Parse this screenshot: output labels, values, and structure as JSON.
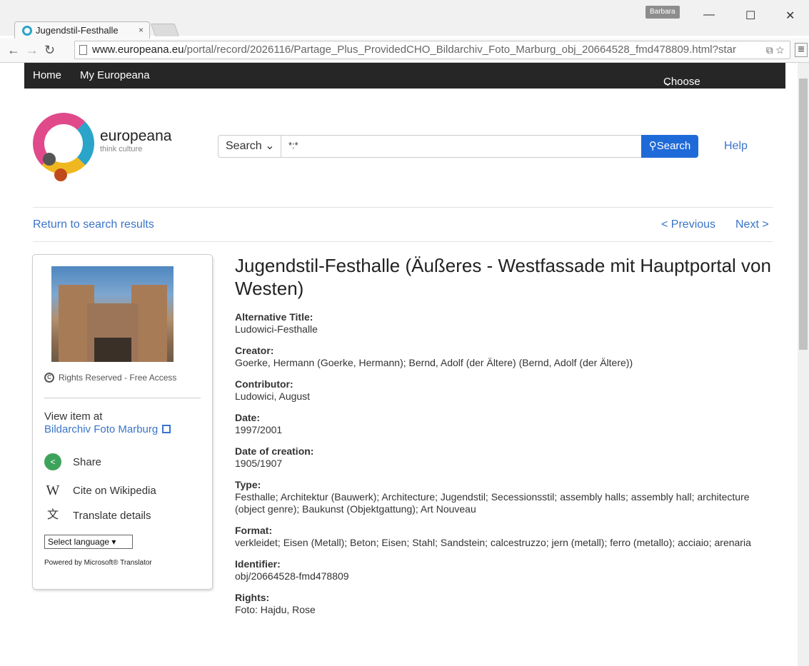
{
  "browser": {
    "tab_title": "Jugendstil-Festhalle",
    "tab_close": "×",
    "profile": "Barbara",
    "url_host": "www.europeana.eu",
    "url_path": "/portal/record/2026116/Partage_Plus_ProvidedCHO_Bildarchiv_Foto_Marburg_obj_20664528_fmd478809.html?star"
  },
  "nav": {
    "home": "Home",
    "my": "My Europeana",
    "language": "Choose a language"
  },
  "brand": {
    "name": "europeana",
    "tagline": "think culture"
  },
  "search": {
    "mode": "Search",
    "query": "*:*",
    "button": "Search",
    "help": "Help"
  },
  "pager": {
    "return": "Return to search results",
    "previous": "< Previous",
    "next": "Next >"
  },
  "sidebar": {
    "rights": "Rights Reserved - Free Access",
    "view_at": "View item at",
    "provider": "Bildarchiv Foto Marburg",
    "share": "Share",
    "cite": "Cite on Wikipedia",
    "translate": "Translate details",
    "select_language": "Select language",
    "powered_by": "Powered by Microsoft® Translator"
  },
  "record": {
    "title": "Jugendstil-Festhalle (Äußeres - Westfassade mit Hauptportal von Westen)",
    "fields": [
      {
        "label": "Alternative Title:",
        "value": "Ludowici-Festhalle"
      },
      {
        "label": "Creator:",
        "value": "Goerke, Hermann (Goerke, Hermann); Bernd, Adolf (der Ältere) (Bernd, Adolf (der Ältere))"
      },
      {
        "label": "Contributor:",
        "value": "Ludowici, August"
      },
      {
        "label": "Date:",
        "value": "1997/2001"
      },
      {
        "label": "Date of creation:",
        "value": "1905/1907"
      },
      {
        "label": "Type:",
        "value": "Festhalle; Architektur (Bauwerk); Architecture; Jugendstil; Secessionsstil; assembly halls; assembly hall; architecture (object genre); Baukunst (Objektgattung); Art Nouveau"
      },
      {
        "label": "Format:",
        "value": "verkleidet; Eisen (Metall); Beton; Eisen; Stahl; Sandstein; calcestruzzo; jern (metall); ferro (metallo); acciaio; arenaria"
      },
      {
        "label": "Identifier:",
        "value": "obj/20664528-fmd478809"
      },
      {
        "label": "Rights:",
        "value": "Foto: Hajdu, Rose"
      }
    ]
  }
}
